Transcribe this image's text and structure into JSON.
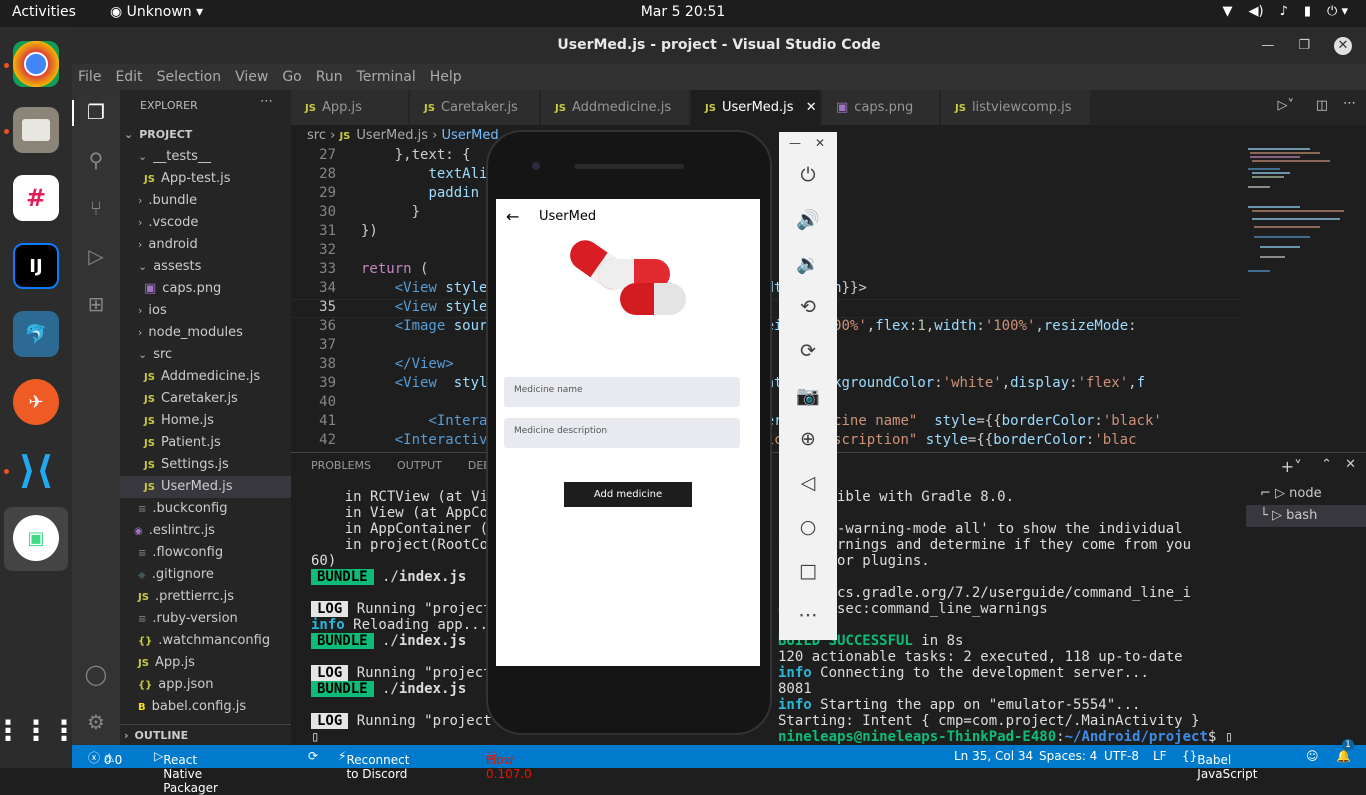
{
  "topbar": {
    "activities": "Activities",
    "app": "Unknown",
    "clock": "Mar 5  20:51"
  },
  "window": {
    "title": "UserMed.js - project - Visual Studio Code"
  },
  "menu": [
    "File",
    "Edit",
    "Selection",
    "View",
    "Go",
    "Run",
    "Terminal",
    "Help"
  ],
  "explorer": {
    "header": "EXPLORER",
    "project": "PROJECT",
    "outline": "OUTLINE",
    "items": [
      "__tests__",
      "App-test.js",
      ".bundle",
      ".vscode",
      "android",
      "assests",
      "caps.png",
      "ios",
      "node_modules",
      "src",
      "Addmedicine.js",
      "Caretaker.js",
      "Home.js",
      "Patient.js",
      "Settings.js",
      "UserMed.js",
      ".buckconfig",
      ".eslintrc.js",
      ".flowconfig",
      ".gitignore",
      ".prettierrc.js",
      ".ruby-version",
      ".watchmanconfig",
      "App.js",
      "app.json",
      "babel.config.js"
    ]
  },
  "tabs": [
    "App.js",
    "Caretaker.js",
    "Addmedicine.js",
    "UserMed.js",
    "caps.png",
    "listviewcomp.js"
  ],
  "breadcrumb": {
    "src": "src",
    "file": "UserMed.js",
    "sym": "UserMed"
  },
  "code": {
    "lines": [
      "27",
      "28",
      "29",
      "30",
      "31",
      "32",
      "33",
      "34",
      "35",
      "36",
      "37",
      "38",
      "39",
      "40",
      "41",
      "42"
    ]
  },
  "panel": {
    "tabs": [
      "PROBLEMS",
      "OUTPUT",
      "DEBU"
    ],
    "terminals": [
      "node",
      "bash"
    ]
  },
  "phone": {
    "app_title": "UserMed",
    "name_placeholder": "Medicine name",
    "desc_placeholder": "Medicine description",
    "add_button": "Add medicine"
  },
  "status": {
    "errors": "0",
    "warnings": "0",
    "packager": "React Native Packager",
    "discord": "Reconnect to Discord",
    "flow": "Flow 0.107.0",
    "position": "Ln 35, Col 34",
    "spaces": "Spaces: 4",
    "encoding": "UTF-8",
    "eol": "LF",
    "language": "Babel JavaScript",
    "notif": "1"
  }
}
